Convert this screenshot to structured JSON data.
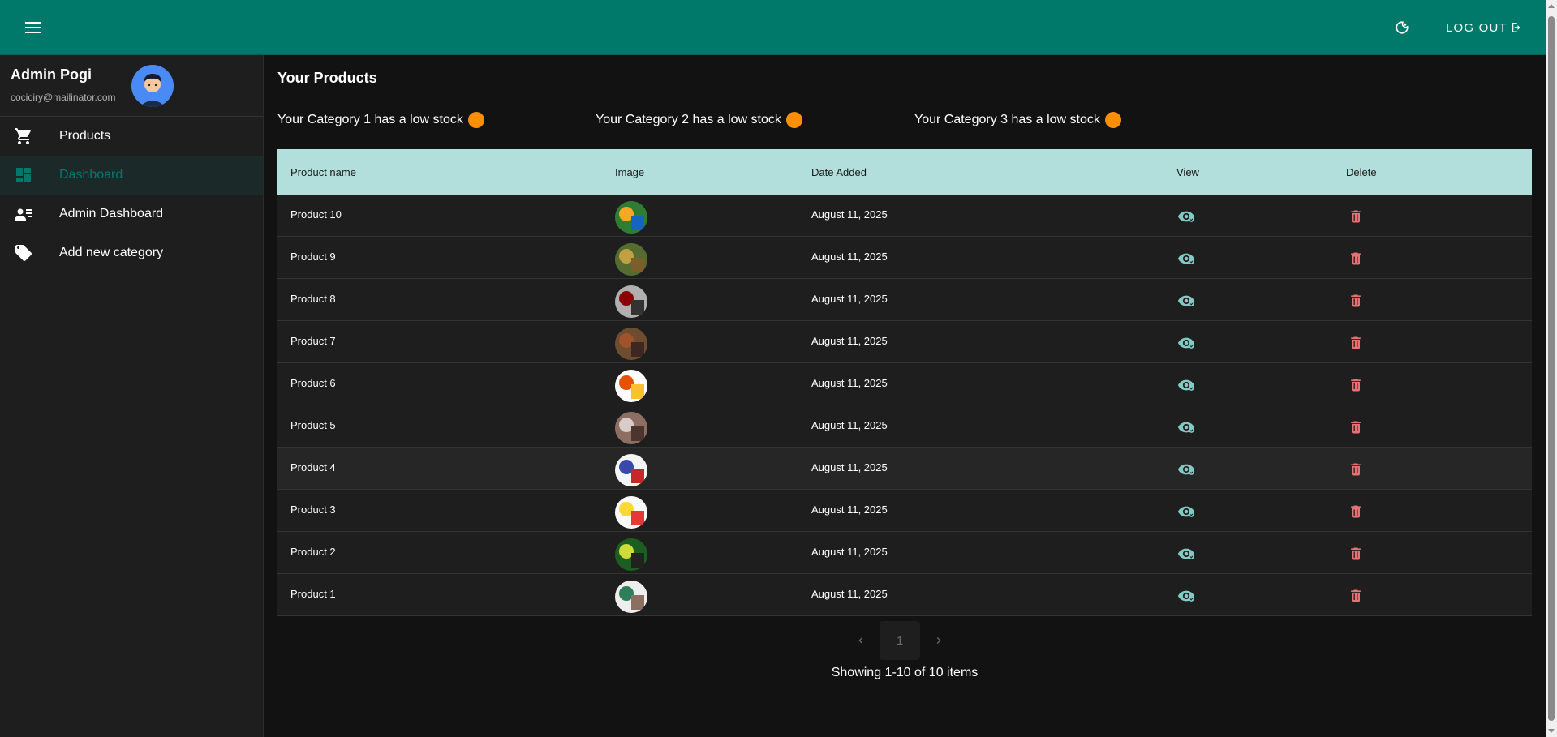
{
  "header": {
    "logout_label": "LOG OUT",
    "brand_color": "#00796b",
    "icons": [
      "menu-icon",
      "theme-toggle-icon",
      "logout-icon"
    ]
  },
  "sidebar": {
    "profile": {
      "name": "Admin Pogi",
      "email": "cociciry@mailinator.com"
    },
    "items": [
      {
        "label": "Products",
        "icon": "cart-icon",
        "active": false
      },
      {
        "label": "Dashboard",
        "icon": "dashboard-icon",
        "active": true
      },
      {
        "label": "Admin Dashboard",
        "icon": "admin-list-icon",
        "active": false
      },
      {
        "label": "Add new category",
        "icon": "tag-icon",
        "active": false
      }
    ]
  },
  "main": {
    "title": "Your Products",
    "alerts": [
      {
        "text": "Your Category 1 has a low stock",
        "color": "#ff8f00"
      },
      {
        "text": "Your Category 2 has a low stock",
        "color": "#ff8f00"
      },
      {
        "text": "Your Category 3 has a low stock",
        "color": "#ff8f00"
      }
    ],
    "table": {
      "columns": [
        "Product name",
        "Image",
        "Date Added",
        "View",
        "Delete"
      ],
      "header_color": "#b2dfdb",
      "rows": [
        {
          "name": "Product 10",
          "date": "August 11, 2025"
        },
        {
          "name": "Product 9",
          "date": "August 11, 2025"
        },
        {
          "name": "Product 8",
          "date": "August 11, 2025"
        },
        {
          "name": "Product 7",
          "date": "August 11, 2025"
        },
        {
          "name": "Product 6",
          "date": "August 11, 2025"
        },
        {
          "name": "Product 5",
          "date": "August 11, 2025"
        },
        {
          "name": "Product 4",
          "date": "August 11, 2025"
        },
        {
          "name": "Product 3",
          "date": "August 11, 2025"
        },
        {
          "name": "Product 2",
          "date": "August 11, 2025"
        },
        {
          "name": "Product 1",
          "date": "August 11, 2025"
        }
      ]
    },
    "pagination": {
      "current_page": "1",
      "showing_text": "Showing 1-10 of 10 items"
    }
  }
}
